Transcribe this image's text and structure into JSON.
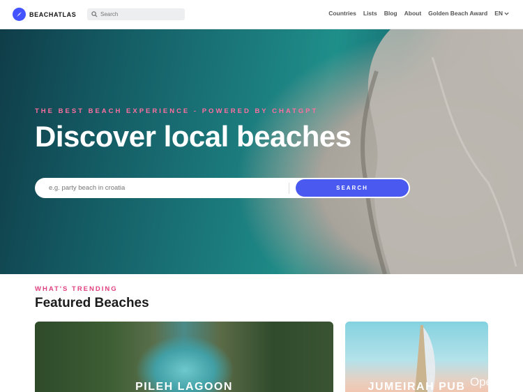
{
  "header": {
    "logo_text": "BEACHATLAS",
    "search_placeholder": "Search",
    "nav": [
      "Countries",
      "Lists",
      "Blog",
      "About",
      "Golden Beach Award"
    ],
    "language": "EN"
  },
  "hero": {
    "tagline": "THE BEST BEACH EXPERIENCE - POWERED BY CHATGPT",
    "title": "Discover local beaches",
    "search_placeholder": "e.g. party beach in croatia",
    "search_button": "SEARCH"
  },
  "featured": {
    "label": "WHAT'S TRENDING",
    "title": "Featured Beaches",
    "cards": [
      {
        "name": "PILEH LAGOON"
      },
      {
        "name": "JUMEIRAH PUB"
      }
    ]
  },
  "watermark": "Openl.cn"
}
